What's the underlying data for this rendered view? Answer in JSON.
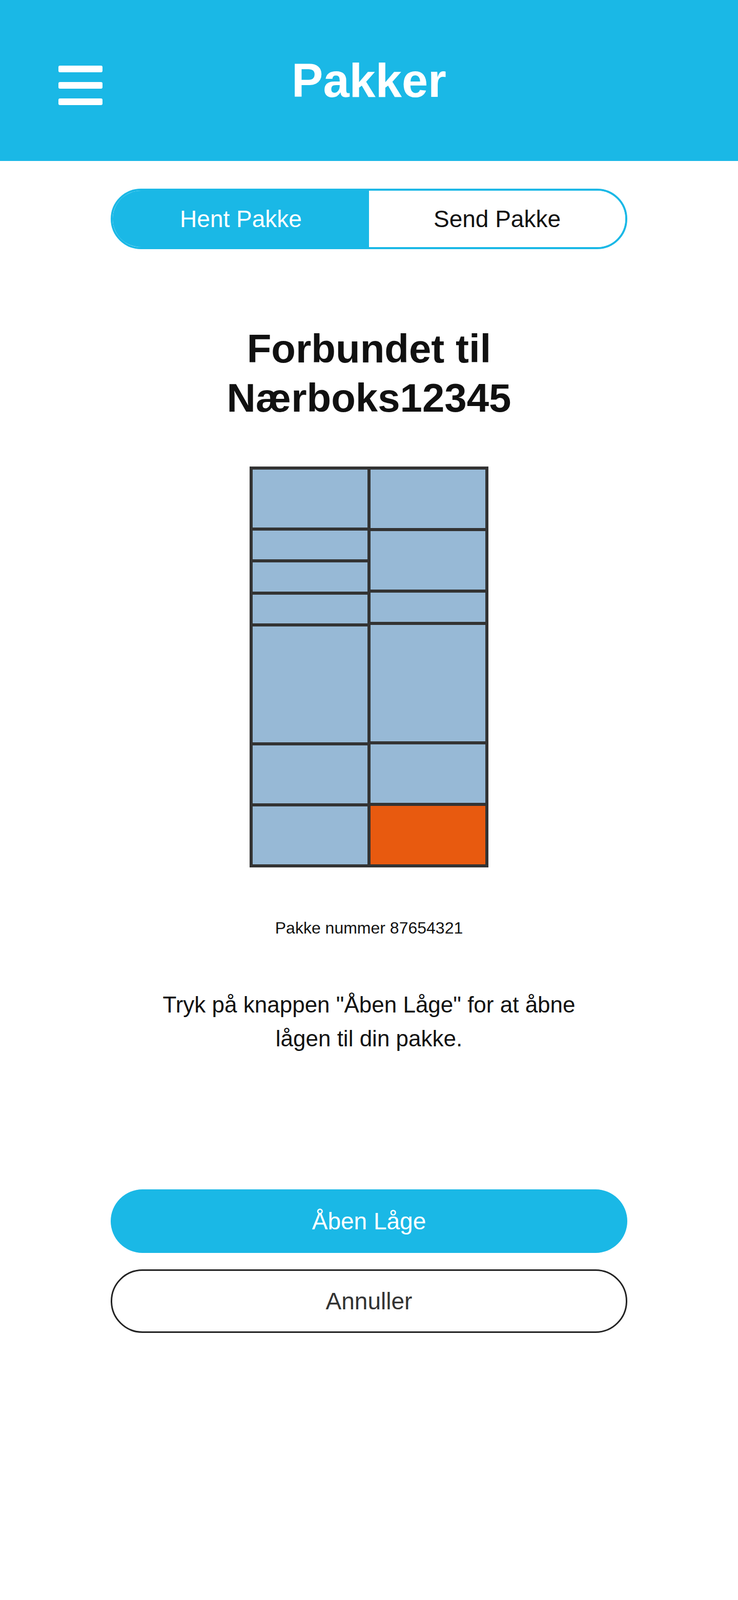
{
  "header": {
    "title": "Pakker"
  },
  "tabs": [
    {
      "label": "Hent Pakke",
      "selected": true
    },
    {
      "label": "Send Pakke",
      "selected": false
    }
  ],
  "connection": {
    "lines": [
      "Forbundet til",
      "Nærboks12345"
    ]
  },
  "locker": {
    "columns": [
      {
        "compartments": [
          {
            "kind": "m",
            "selected": false
          },
          {
            "kind": "s",
            "selected": false
          },
          {
            "kind": "s",
            "selected": false
          },
          {
            "kind": "s",
            "selected": false
          },
          {
            "kind": "l",
            "selected": false
          },
          {
            "kind": "m",
            "selected": false
          },
          {
            "kind": "m",
            "selected": false
          }
        ]
      },
      {
        "compartments": [
          {
            "kind": "m",
            "selected": false
          },
          {
            "kind": "m",
            "selected": false
          },
          {
            "kind": "s",
            "selected": false
          },
          {
            "kind": "l",
            "selected": false
          },
          {
            "kind": "m",
            "selected": false
          },
          {
            "kind": "m",
            "selected": true
          }
        ]
      }
    ]
  },
  "package": {
    "number": "Pakke nummer 87654321"
  },
  "instruction": {
    "lines": [
      "Tryk på knappen \"Åben Låge\" for at åbne",
      "lågen til din pakke."
    ]
  },
  "buttons": [
    {
      "label": "Åben Låge",
      "kind": "primary"
    },
    {
      "label": "Annuller",
      "kind": "secondary"
    }
  ]
}
